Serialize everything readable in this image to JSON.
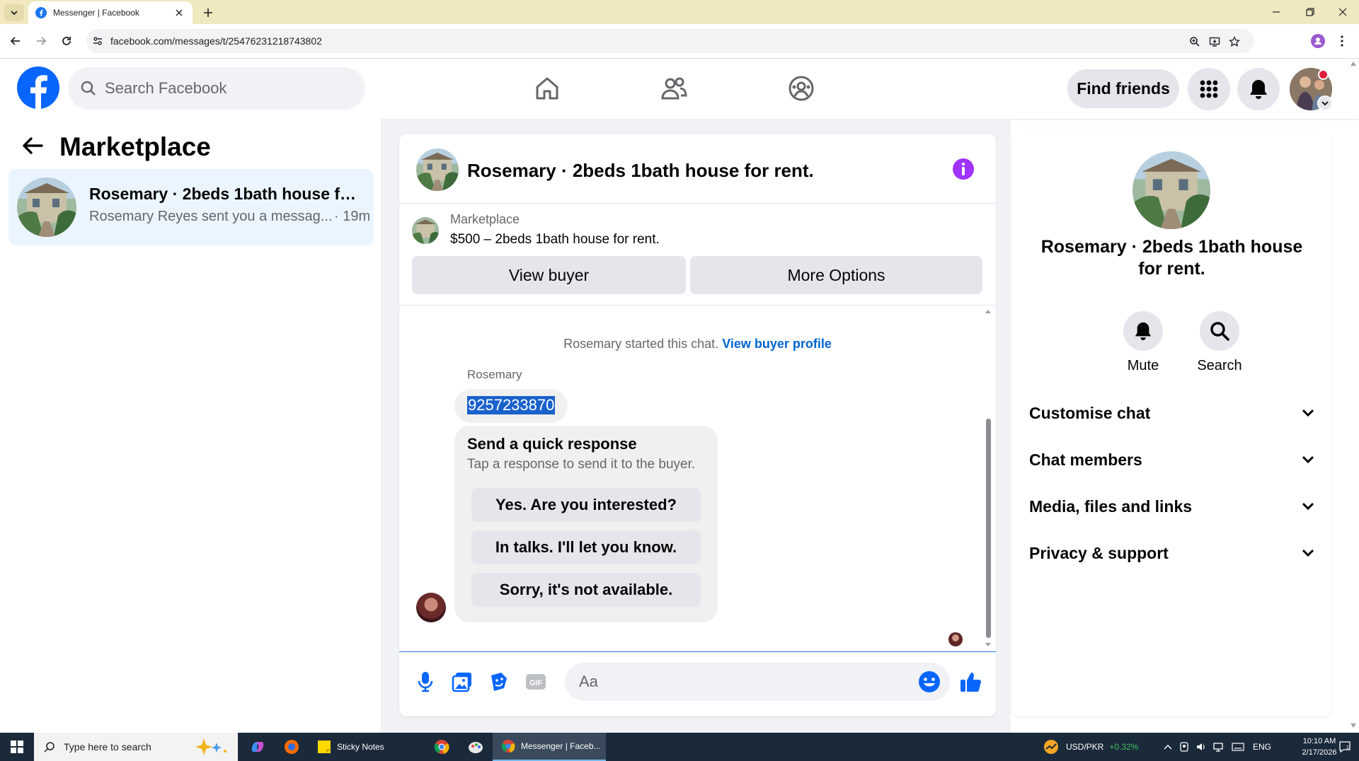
{
  "browser": {
    "tab_title": "Messenger | Facebook",
    "url": "facebook.com/messages/t/25476231218743802"
  },
  "fb": {
    "search_placeholder": "Search Facebook",
    "find_friends": "Find friends"
  },
  "left": {
    "title": "Marketplace",
    "thread": {
      "name": "Rosemary · 2beds 1bath house for ...",
      "preview": "Rosemary Reyes sent you a messag...",
      "time": "· 19m"
    }
  },
  "chat": {
    "header_title": "Rosemary · 2beds 1bath house for rent.",
    "listing": {
      "label": "Marketplace",
      "title": "$500 – 2beds 1bath house for rent.",
      "view_buyer": "View buyer",
      "more_options": "More Options"
    },
    "started_text": "Rosemary started this chat.",
    "view_profile": "View buyer profile",
    "sender": "Rosemary",
    "phone": "9257233870",
    "quick": {
      "title": "Send a quick response",
      "subtitle": "Tap a response to send it to the buyer.",
      "options": [
        "Yes. Are you interested?",
        "In talks. I'll let you know.",
        "Sorry, it's not available."
      ]
    },
    "input_placeholder": "Aa"
  },
  "right": {
    "title": "Rosemary · 2beds 1bath house for rent.",
    "mute": "Mute",
    "search": "Search",
    "sections": [
      "Customise chat",
      "Chat members",
      "Media, files and links",
      "Privacy & support"
    ]
  },
  "taskbar": {
    "search_placeholder": "Type here to search",
    "sticky_notes": "Sticky Notes",
    "messenger": "Messenger | Faceb...",
    "currency": "USD/PKR",
    "currency_change": "+0.32%",
    "lang": "ENG",
    "time": "10:10 AM",
    "date": "2/17/2026"
  },
  "colors": {
    "fb_blue": "#0866ff",
    "link_blue": "#0064d1",
    "thread_highlight": "#ebf5ff",
    "info_purple": "#a033ff",
    "selection_blue": "#1a61cc"
  }
}
